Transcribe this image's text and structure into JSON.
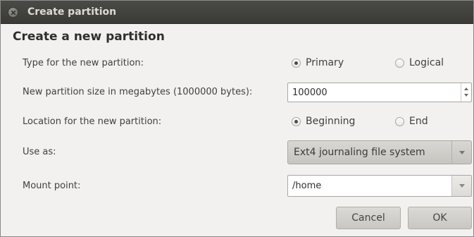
{
  "window": {
    "title": "Create partition"
  },
  "dialog": {
    "heading": "Create a new partition"
  },
  "fields": {
    "type": {
      "label": "Type for the new partition:",
      "options": [
        "Primary",
        "Logical"
      ],
      "selected": "Primary"
    },
    "size": {
      "label": "New partition size in megabytes (1000000 bytes):",
      "value": "100000"
    },
    "location": {
      "label": "Location for the new partition:",
      "options": [
        "Beginning",
        "End"
      ],
      "selected": "Beginning"
    },
    "use_as": {
      "label": "Use as:",
      "value": "Ext4 journaling file system"
    },
    "mount_point": {
      "label": "Mount point:",
      "value": "/home"
    }
  },
  "buttons": {
    "cancel": "Cancel",
    "ok": "OK"
  }
}
